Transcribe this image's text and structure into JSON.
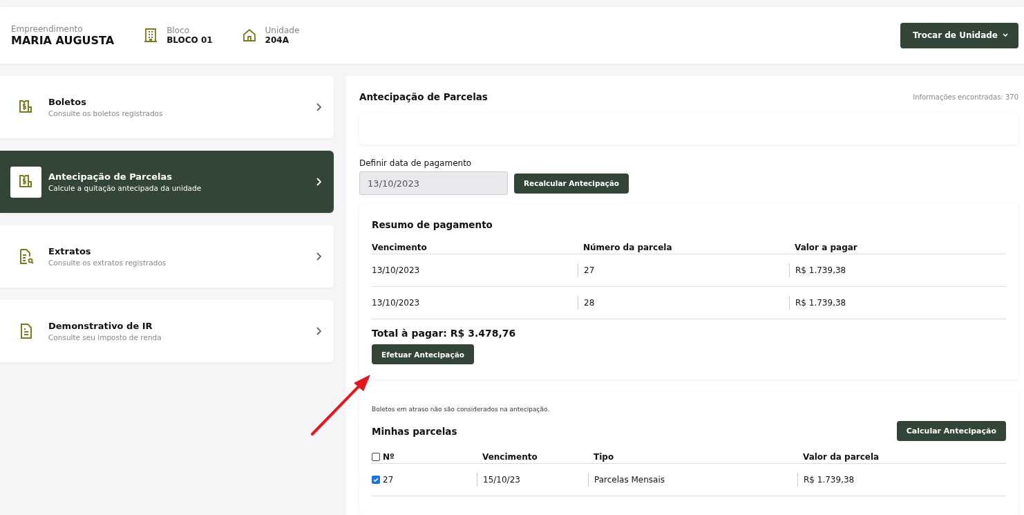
{
  "header": {
    "empreendimento": {
      "label": "Empreendimento",
      "value": "MARIA AUGUSTA"
    },
    "bloco": {
      "label": "Bloco",
      "value": "BLOCO 01"
    },
    "unidade": {
      "label": "Unidade",
      "value": "204A"
    },
    "button": "Trocar de Unidade"
  },
  "sidebar": {
    "items": [
      {
        "kind": "receipt",
        "title": "Boletos",
        "subtitle": "Consulte os boletos registrados",
        "selected": false
      },
      {
        "kind": "receipt",
        "title": "Antecipação de Parcelas",
        "subtitle": "Calcule a quitação antecipada da unidade",
        "selected": true
      },
      {
        "kind": "search-doc",
        "title": "Extratos",
        "subtitle": "Consulte os extratos registrados",
        "selected": false
      },
      {
        "kind": "doc",
        "title": "Demonstrativo de IR",
        "subtitle": "Consulte seu imposto de renda",
        "selected": false
      }
    ]
  },
  "main": {
    "title": "Antecipação de Parcelas",
    "count": "Informações encontradas: 370",
    "date_label": "Definir data de pagamento",
    "date_value": "13/10/2023",
    "recalc_button": "Recalcular Antecipação",
    "summary": {
      "title": "Resumo de pagamento",
      "columns": [
        "Vencimento",
        "Número da parcela",
        "Valor a pagar"
      ],
      "rows": [
        [
          "13/10/2023",
          "27",
          "R$ 1.739,38"
        ],
        [
          "13/10/2023",
          "28",
          "R$ 1.739,38"
        ]
      ],
      "total": "Total à pagar: R$ 3.478,76",
      "button": "Efetuar Antecipação"
    },
    "parcelas": {
      "note": "Boletos em atraso não são considerados na antecipação.",
      "title": "Minhas parcelas",
      "button": "Calcular Antecipação",
      "all_checked": false,
      "columns": [
        "Nº",
        "Vencimento",
        "Tipo",
        "Valor da parcela"
      ],
      "rows": [
        {
          "checked": true,
          "cells": [
            "27",
            "15/10/23",
            "Parcelas Mensais",
            "R$ 1.739,38"
          ]
        }
      ]
    }
  }
}
